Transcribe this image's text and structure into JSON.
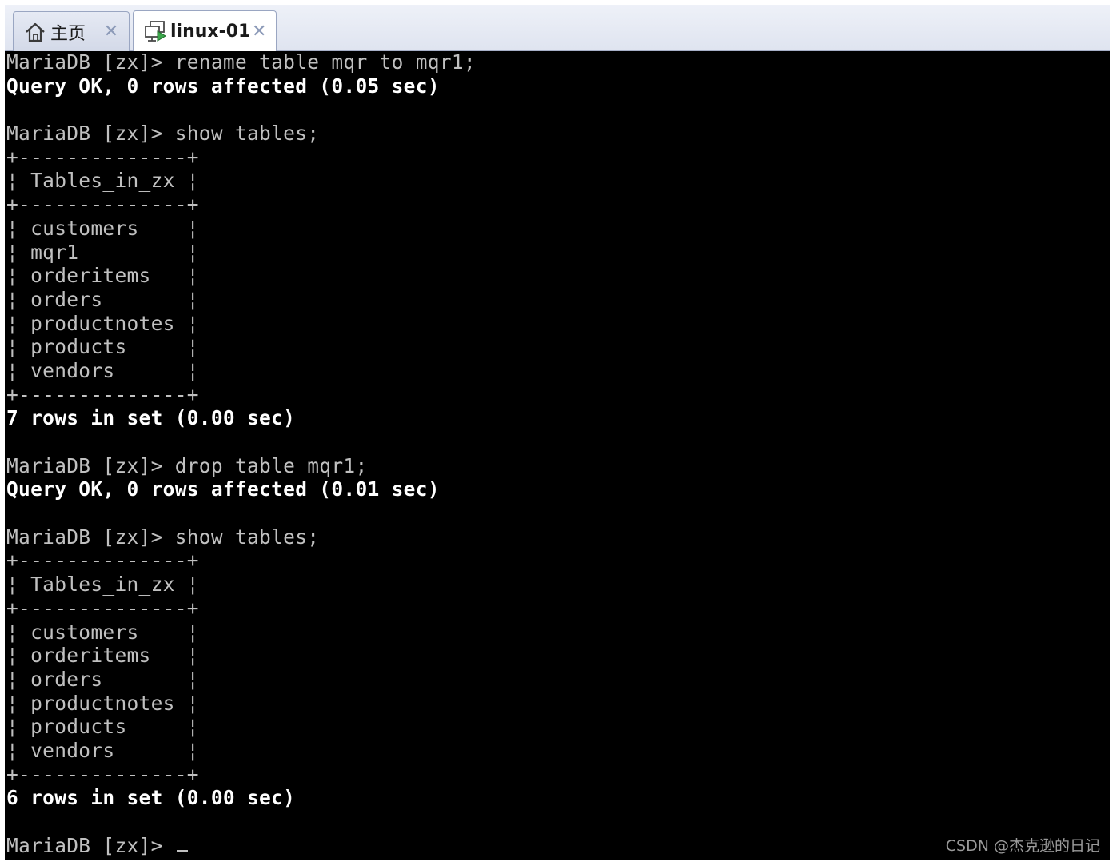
{
  "tabs": [
    {
      "label": "主页",
      "icon": "home-icon",
      "active": false
    },
    {
      "label": "linux-01",
      "icon": "vm-console-icon",
      "active": true
    }
  ],
  "terminal": {
    "lines": [
      {
        "text": "MariaDB [zx]> rename table mqr to mqr1;",
        "style": "normal"
      },
      {
        "text": "Query OK, 0 rows affected (0.05 sec)",
        "style": "bright"
      },
      {
        "text": "",
        "style": "normal"
      },
      {
        "text": "MariaDB [zx]> show tables;",
        "style": "normal"
      },
      {
        "text": "+--------------+",
        "style": "normal"
      },
      {
        "text": "¦ Tables_in_zx ¦",
        "style": "normal"
      },
      {
        "text": "+--------------+",
        "style": "normal"
      },
      {
        "text": "¦ customers    ¦",
        "style": "normal"
      },
      {
        "text": "¦ mqr1         ¦",
        "style": "normal"
      },
      {
        "text": "¦ orderitems   ¦",
        "style": "normal"
      },
      {
        "text": "¦ orders       ¦",
        "style": "normal"
      },
      {
        "text": "¦ productnotes ¦",
        "style": "normal"
      },
      {
        "text": "¦ products     ¦",
        "style": "normal"
      },
      {
        "text": "¦ vendors      ¦",
        "style": "normal"
      },
      {
        "text": "+--------------+",
        "style": "normal"
      },
      {
        "text": "7 rows in set (0.00 sec)",
        "style": "bright"
      },
      {
        "text": "",
        "style": "normal"
      },
      {
        "text": "MariaDB [zx]> drop table mqr1;",
        "style": "normal"
      },
      {
        "text": "Query OK, 0 rows affected (0.01 sec)",
        "style": "bright"
      },
      {
        "text": "",
        "style": "normal"
      },
      {
        "text": "MariaDB [zx]> show tables;",
        "style": "normal"
      },
      {
        "text": "+--------------+",
        "style": "normal"
      },
      {
        "text": "¦ Tables_in_zx ¦",
        "style": "normal"
      },
      {
        "text": "+--------------+",
        "style": "normal"
      },
      {
        "text": "¦ customers    ¦",
        "style": "normal"
      },
      {
        "text": "¦ orderitems   ¦",
        "style": "normal"
      },
      {
        "text": "¦ orders       ¦",
        "style": "normal"
      },
      {
        "text": "¦ productnotes ¦",
        "style": "normal"
      },
      {
        "text": "¦ products     ¦",
        "style": "normal"
      },
      {
        "text": "¦ vendors      ¦",
        "style": "normal"
      },
      {
        "text": "+--------------+",
        "style": "normal"
      },
      {
        "text": "6 rows in set (0.00 sec)",
        "style": "bright"
      },
      {
        "text": "",
        "style": "normal"
      }
    ],
    "prompt": "MariaDB [zx]> "
  },
  "watermark": "CSDN @杰克逊的日记",
  "colors": {
    "terminal_bg": "#000000",
    "terminal_fg": "#c0c0c0",
    "terminal_bright": "#ffffff",
    "tabbar_bg": "#e4e8f2",
    "tab_close": "#8c9ab8"
  }
}
